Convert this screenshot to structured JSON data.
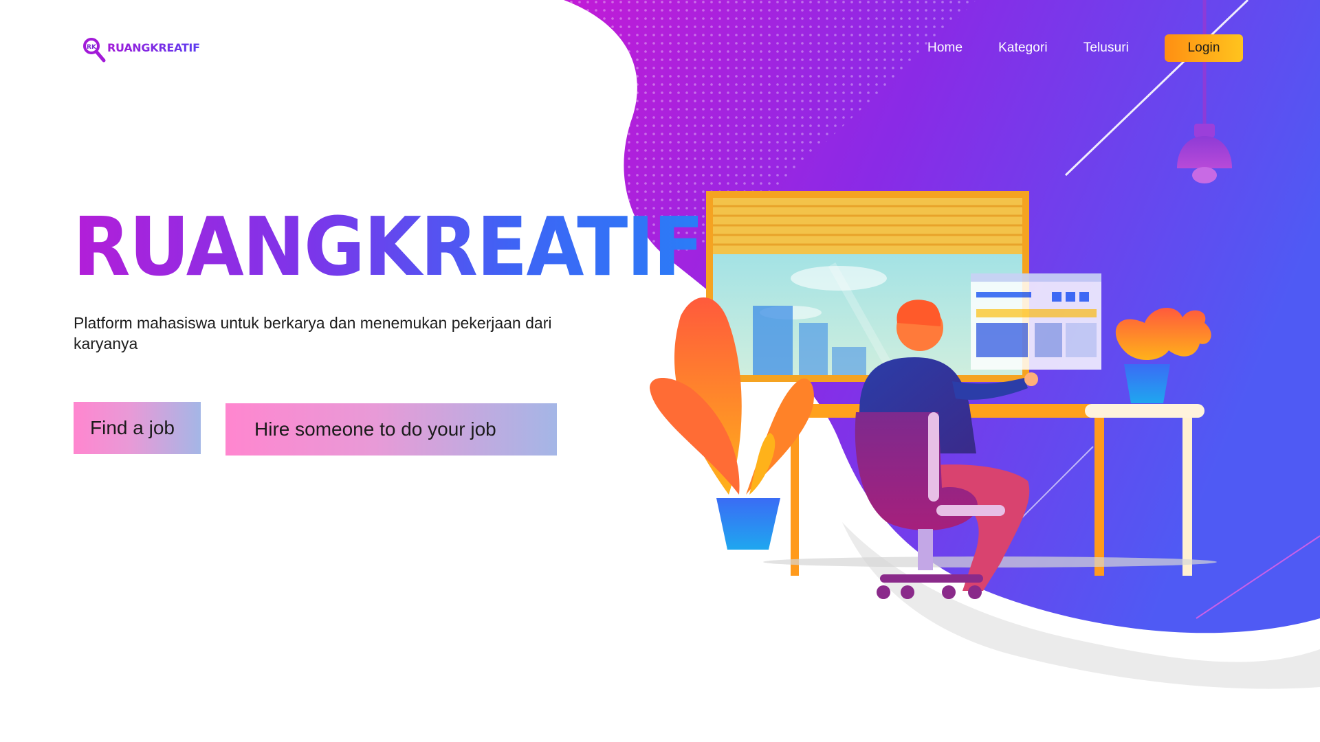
{
  "brand": {
    "logo_badge": "RK",
    "logo_text": "RUANGKREATIF"
  },
  "nav": {
    "items": [
      "Home",
      "Kategori",
      "Telusuri"
    ],
    "login_label": "Login"
  },
  "hero": {
    "title": "RUANGKREATIF",
    "subtitle": "Platform mahasiswa untuk berkarya dan menemukan pekerjaan dari karyanya",
    "cta_primary": "Find a job",
    "cta_secondary": "Hire someone to do your job"
  },
  "colors": {
    "accent_purple": "#a21ad8",
    "accent_blue": "#3e64f5",
    "login_orange": "#ff9c14",
    "cta_pink": "#ff86cf"
  },
  "icons": [
    "search-icon",
    "pendant-lamp-icon"
  ]
}
